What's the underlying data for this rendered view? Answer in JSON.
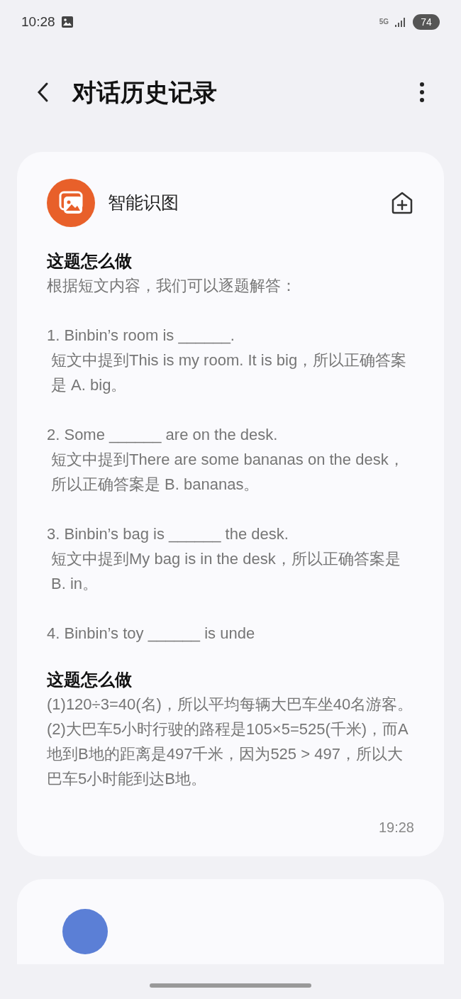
{
  "status_bar": {
    "time": "10:28",
    "network": "5G",
    "battery": "74"
  },
  "header": {
    "title": "对话历史记录"
  },
  "cards": [
    {
      "app_name": "智能识图",
      "questions": [
        {
          "heading": "这题怎么做",
          "paragraphs": [
            [
              "根据短文内容，我们可以逐题解答："
            ],
            [
              "1. Binbin’s room is ______.",
              "短文中提到This is my room. It is big，所以正确答案是 A. big。"
            ],
            [
              "2. Some ______ are on the desk.",
              "短文中提到There are some bananas on the desk，所以正确答案是 B. bananas。"
            ],
            [
              "3. Binbin’s bag is ______ the desk.",
              "短文中提到My bag is in the desk，所以正确答案是 B. in。"
            ],
            [
              "4. Binbin’s toy ______ is unde"
            ]
          ]
        },
        {
          "heading": "这题怎么做",
          "paragraphs": [
            [
              "(1)120÷3=40(名)，所以平均每辆大巴车坐40名游客。",
              "(2)大巴车5小时行驶的路程是105×5=525(千米)，而A地到B地的距离是497千米，因为525 > 497，所以大巴车5小时能到达B地。"
            ]
          ]
        }
      ],
      "time": "19:28"
    },
    {
      "kind": "partial"
    }
  ]
}
